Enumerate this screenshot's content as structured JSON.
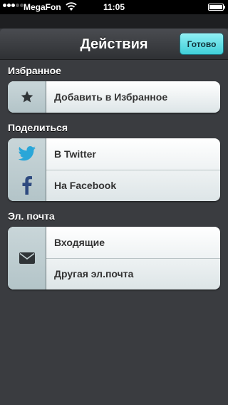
{
  "status_bar": {
    "carrier": "MegaFon",
    "time": "11:05"
  },
  "navbar": {
    "title": "Действия",
    "done_label": "Готово"
  },
  "sections": {
    "favorites": {
      "header": "Избранное",
      "items": [
        {
          "label": "Добавить в Избранное",
          "icon": "star-icon"
        }
      ]
    },
    "share": {
      "header": "Поделиться",
      "items": [
        {
          "label": "В Twitter",
          "icon": "twitter-icon"
        },
        {
          "label": "На Facebook",
          "icon": "facebook-icon"
        }
      ]
    },
    "email": {
      "header": "Эл. почта",
      "icon": "envelope-icon",
      "items": [
        {
          "label": "Входящие"
        },
        {
          "label": "Другая эл.почта"
        }
      ]
    }
  },
  "colors": {
    "background": "#3a3c40",
    "done_button": "#5fdde4",
    "row_text": "#333333"
  }
}
